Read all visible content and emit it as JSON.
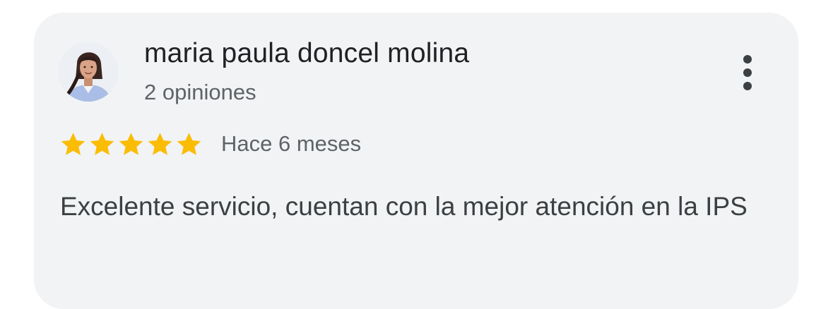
{
  "review": {
    "reviewer_name": "maria paula doncel molina",
    "review_count": "2 opiniones",
    "rating": 5,
    "rating_max": 5,
    "time_ago": "Hace 6 meses",
    "text": "Excelente servicio, cuentan con la mejor atención en la IPS"
  },
  "icons": {
    "avatar": "avatar-photo",
    "menu": "more-vert-icon",
    "star": "star-icon"
  },
  "colors": {
    "card_bg": "#f1f3f4",
    "star": "#fbbc04",
    "name": "#202124",
    "secondary": "#5f6368",
    "body": "#3c4043"
  }
}
